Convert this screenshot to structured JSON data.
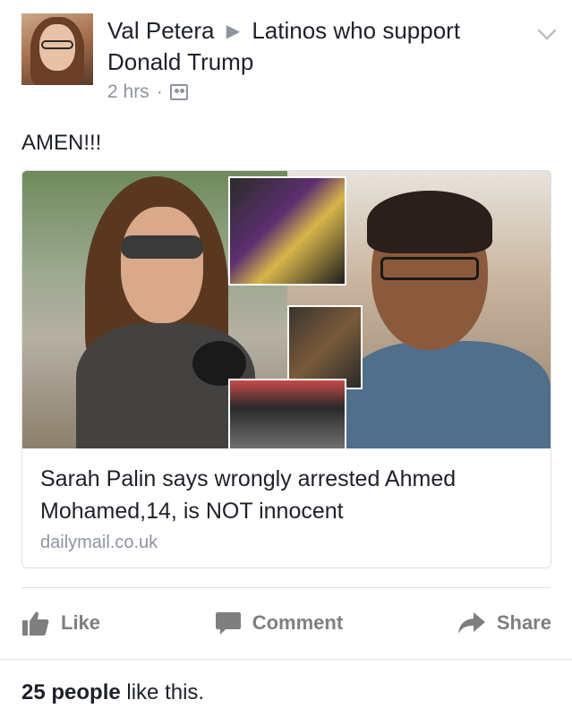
{
  "post": {
    "author": "Val Petera",
    "group": "Latinos who support Donald Trump",
    "time": "2 hrs",
    "separator": "·",
    "text": "AMEN!!!"
  },
  "link": {
    "title": "Sarah Palin says wrongly arrested Ahmed Mohamed,14, is NOT innocent",
    "domain": "dailymail.co.uk"
  },
  "actions": {
    "like": "Like",
    "comment": "Comment",
    "share": "Share"
  },
  "likes": {
    "count": "25 people",
    "suffix": "like this."
  },
  "icons": {
    "privacy": "group-members-icon",
    "menu": "chevron-down-icon",
    "like": "thumbs-up-icon",
    "comment": "speech-bubble-icon",
    "share": "share-arrow-icon"
  },
  "colors": {
    "text": "#1d2129",
    "secondary": "#8d949e",
    "action": "#7f7f7f",
    "border": "#dddfe2"
  }
}
